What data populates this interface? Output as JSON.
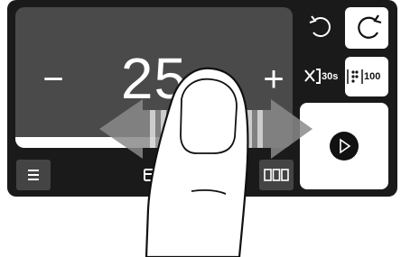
{
  "display": {
    "value": "25",
    "minus_label": "−",
    "plus_label": "+",
    "progress_fraction": 0.62
  },
  "buttons": {
    "skip_time_label": "30s",
    "count_label": "100"
  },
  "icons": {
    "menu": "menu-icon",
    "card": "card-icon",
    "grid": "grid-icon",
    "undo": "undo-icon",
    "redo": "redo-icon",
    "skip": "skip-icon",
    "counter": "counter-icon",
    "play": "play-icon",
    "finger": "finger-swipe-icon"
  },
  "colors": {
    "panel": "#1a1a1a",
    "display": "#4a4a4a",
    "accent": "#ffffff",
    "arrow": "#8a8a8a"
  }
}
